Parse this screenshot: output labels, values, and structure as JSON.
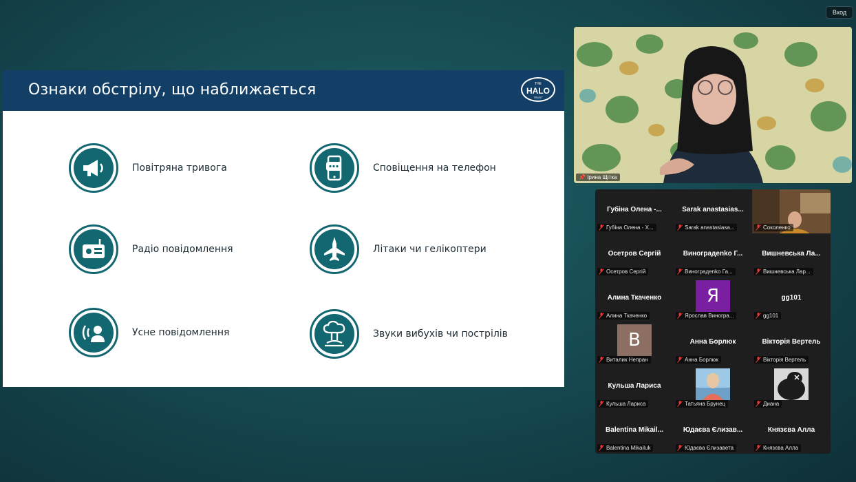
{
  "header": {
    "signin_label": "Вход"
  },
  "slide": {
    "title": "Ознаки обстрілу, що наближається",
    "logo": {
      "line1": "THE",
      "line2": "HALO",
      "line3": "TRUST"
    },
    "items": [
      {
        "label": "Повітряна тривога",
        "icon": "megaphone-icon"
      },
      {
        "label": "Сповіщення на телефон",
        "icon": "phone-message-icon"
      },
      {
        "label": "Радіо повідомлення",
        "icon": "radio-icon"
      },
      {
        "label": "Літаки чи гелікоптери",
        "icon": "fighter-jet-icon"
      },
      {
        "label": "Усне повідомлення",
        "icon": "person-speaking-icon"
      },
      {
        "label": "Звуки вибухів чи пострілів",
        "icon": "explosion-icon"
      }
    ],
    "accent_color": "#136771",
    "header_color": "#133f66"
  },
  "speaker": {
    "name": "Ірина Щітка"
  },
  "participants": [
    {
      "display": "Губіна Олена -...",
      "tag": "Губіна Олена - Х..."
    },
    {
      "display": "Sarak anastasias...",
      "tag": "Sarak anastasiasa..."
    },
    {
      "display": "",
      "tag": "Соколенко"
    },
    {
      "display": "Осетров Сергій",
      "tag": "Осетров Сергій"
    },
    {
      "display": "Виноградenko Г...",
      "tag": "Виноградenko Га..."
    },
    {
      "display": "Вишневська Ла...",
      "tag": "Вишневська Лар..."
    },
    {
      "display": "Алина Ткаченко",
      "tag": "Алина Ткаченко"
    },
    {
      "display": "",
      "tag": "Ярослав Виногра...",
      "letter": "Я",
      "color": "#7b1fa2"
    },
    {
      "display": "gg101",
      "tag": "gg101"
    },
    {
      "display": "",
      "tag": "Виталик Непран",
      "letter": "В",
      "color": "#8d6e63"
    },
    {
      "display": "Анна Борлюк",
      "tag": "Анна Борлюк"
    },
    {
      "display": "Вікторія Вертель",
      "tag": "Вікторія Вертель"
    },
    {
      "display": "Кульша Лариса",
      "tag": "Кульша Лариса"
    },
    {
      "display": "",
      "tag": "Татьяна Брунец"
    },
    {
      "display": "",
      "tag": "Диана"
    },
    {
      "display": "Balentina Mikail...",
      "tag": "Balentina Mikailuk"
    },
    {
      "display": "Юдаєва Єлизав...",
      "tag": "Юдаєва Єлизавета"
    },
    {
      "display": "Князєва Алла",
      "tag": "Князєва Алла"
    }
  ]
}
